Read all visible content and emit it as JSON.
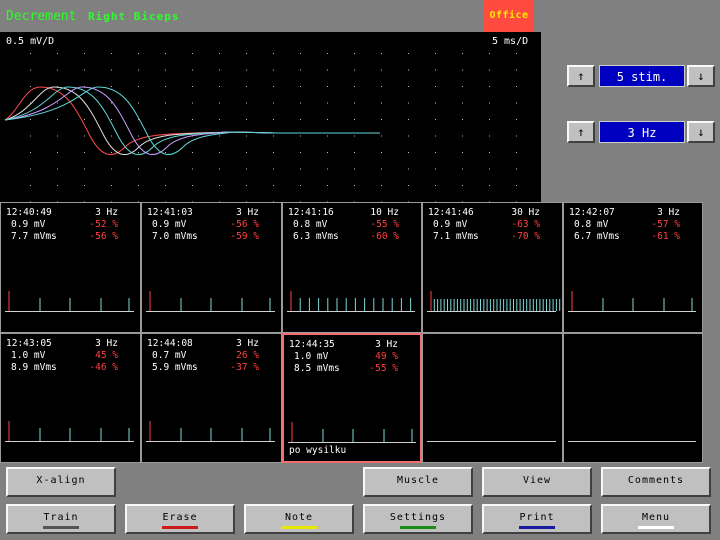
{
  "header": {
    "mode": "Decrement",
    "muscle": "Right Biceps",
    "location": "Office"
  },
  "scope": {
    "amp_scale": "0.5 mV/D",
    "time_scale": "5 ms/D"
  },
  "controls": {
    "up_arrow": "↑",
    "down_arrow": "↓",
    "stim_value": "5 stim.",
    "freq_value": "3 Hz"
  },
  "trains": [
    {
      "time": "12:40:49",
      "freq": "3 Hz",
      "amp": "0.9 mV",
      "amp_pct": "-52 %",
      "area": "7.7 mVms",
      "area_pct": "-56 %",
      "note": "",
      "stim": "sparse"
    },
    {
      "time": "12:41:03",
      "freq": "3 Hz",
      "amp": "0.9 mV",
      "amp_pct": "-56 %",
      "area": "7.0 mVms",
      "area_pct": "-59 %",
      "note": "",
      "stim": "sparse"
    },
    {
      "time": "12:41:16",
      "freq": "10 Hz",
      "amp": "0.8 mV",
      "amp_pct": "-55 %",
      "area": "6.3 mVms",
      "area_pct": "-60 %",
      "note": "",
      "stim": "medium"
    },
    {
      "time": "12:41:46",
      "freq": "30 Hz",
      "amp": "0.9 mV",
      "amp_pct": "-63 %",
      "area": "7.1 mVms",
      "area_pct": "-70 %",
      "note": "",
      "stim": "dense"
    },
    {
      "time": "12:42:07",
      "freq": "3 Hz",
      "amp": "0.8 mV",
      "amp_pct": "-57 %",
      "area": "6.7 mVms",
      "area_pct": "-61 %",
      "note": "",
      "stim": "sparse"
    },
    {
      "time": "12:43:05",
      "freq": "3 Hz",
      "amp": "1.0 mV",
      "amp_pct": "45 %",
      "area": "8.9 mVms",
      "area_pct": "-46 %",
      "note": "",
      "stim": "sparse"
    },
    {
      "time": "12:44:08",
      "freq": "3 Hz",
      "amp": "0.7 mV",
      "amp_pct": "26 %",
      "area": "5.9 mVms",
      "area_pct": "-37 %",
      "note": "",
      "stim": "sparse"
    },
    {
      "time": "12:44:35",
      "freq": "3 Hz",
      "amp": "1.0 mV",
      "amp_pct": "49 %",
      "area": "8.5 mVms",
      "area_pct": "-55 %",
      "note": "po wysilku",
      "stim": "sparse",
      "selected": true
    },
    {
      "time": "",
      "freq": "",
      "amp": "",
      "amp_pct": "",
      "area": "",
      "area_pct": "",
      "note": "",
      "stim": "none"
    },
    {
      "time": "",
      "freq": "",
      "amp": "",
      "amp_pct": "",
      "area": "",
      "area_pct": "",
      "note": "",
      "stim": "none"
    }
  ],
  "buttons": {
    "x_align": "X-align",
    "muscle": "Muscle",
    "view": "View",
    "comments": "Comments",
    "train": "Train",
    "erase": "Erase",
    "note": "Note",
    "settings": "Settings",
    "print": "Print",
    "menu": "Menu"
  },
  "colors": {
    "train": "#555555",
    "erase": "#cc1a1a",
    "note": "#e8e800",
    "settings": "#1a8a1a",
    "print": "#1a1aa0",
    "menu": "#ffffff"
  }
}
